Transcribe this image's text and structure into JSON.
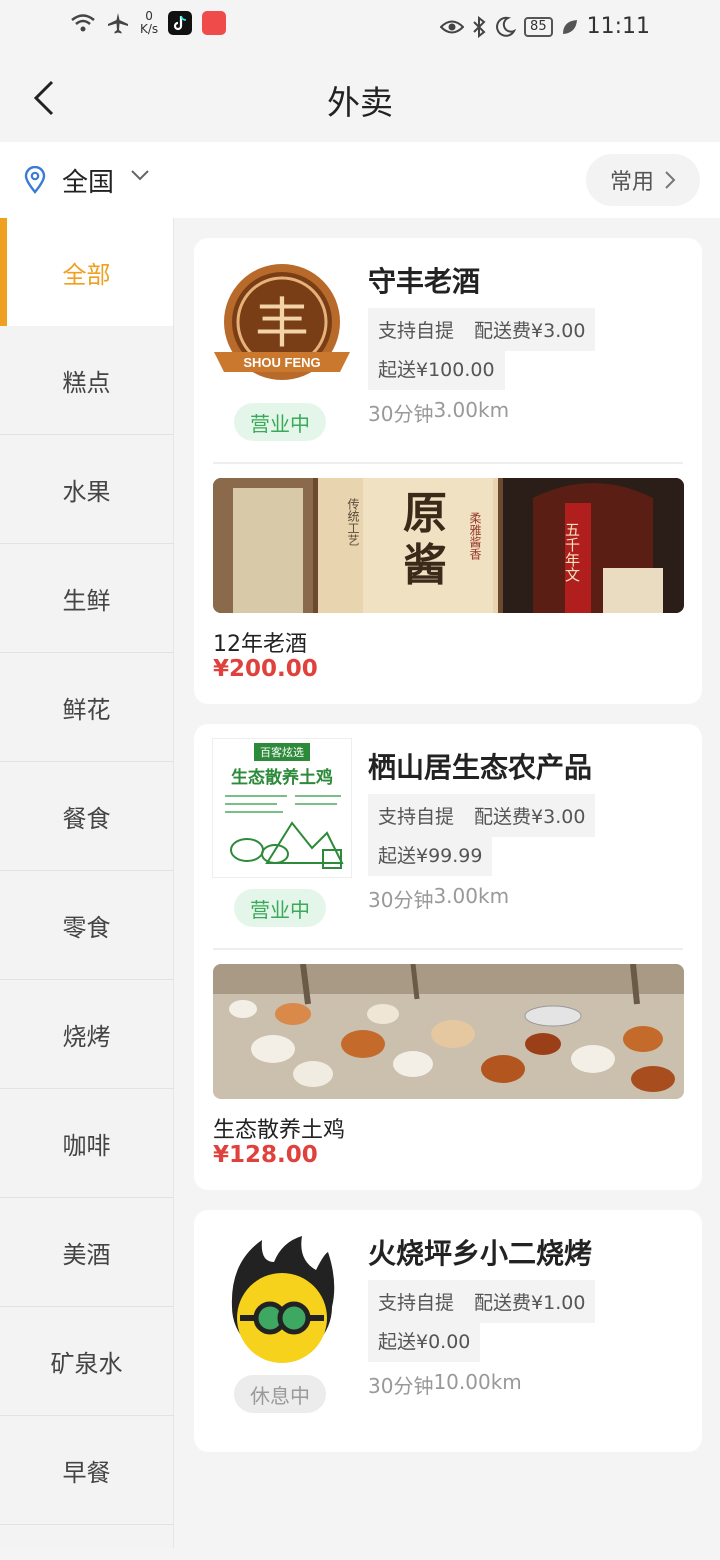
{
  "status_bar": {
    "net_speed_value": "0",
    "net_speed_unit": "K/s",
    "battery": "85",
    "time": "11:11"
  },
  "header": {
    "title": "外卖"
  },
  "location": {
    "city": "全国",
    "common_label": "常用"
  },
  "categories": [
    {
      "label": "全部",
      "active": true
    },
    {
      "label": "糕点"
    },
    {
      "label": "水果"
    },
    {
      "label": "生鲜"
    },
    {
      "label": "鲜花"
    },
    {
      "label": "餐食"
    },
    {
      "label": "零食"
    },
    {
      "label": "烧烤"
    },
    {
      "label": "咖啡"
    },
    {
      "label": "美酒"
    },
    {
      "label": "矿泉水"
    },
    {
      "label": "早餐"
    }
  ],
  "shops": [
    {
      "name": "守丰老酒",
      "status": "营业中",
      "tag_pickup": "支持自提",
      "tag_delivery_fee": "配送费¥3.00",
      "tag_min_order": "起送¥100.00",
      "time": "30分钟",
      "distance": "3.00km",
      "logo_text": "SHOU FENG",
      "logo_char": "丰",
      "product": {
        "name": "12年老酒",
        "price": "¥200.00",
        "img_text_1": "原",
        "img_text_2": "酱",
        "img_side_1": "柔雅酱香",
        "img_side_2": "传统工艺",
        "img_ribbon": "五千年文"
      }
    },
    {
      "name": "栖山居生态农产品",
      "status": "营业中",
      "tag_pickup": "支持自提",
      "tag_delivery_fee": "配送费¥3.00",
      "tag_min_order": "起送¥99.99",
      "time": "30分钟",
      "distance": "3.00km",
      "logo_top": "百客炫选",
      "logo_title": "生态散养土鸡",
      "product": {
        "name": "生态散养土鸡",
        "price": "¥128.00"
      }
    },
    {
      "name": "火烧坪乡小二烧烤",
      "status": "休息中",
      "tag_pickup": "支持自提",
      "tag_delivery_fee": "配送费¥1.00",
      "tag_min_order": "起送¥0.00",
      "time": "30分钟",
      "distance": "10.00km"
    }
  ],
  "colors": {
    "accent": "#f0a020",
    "price": "#e0413c",
    "open_green": "#3aaa5a"
  }
}
